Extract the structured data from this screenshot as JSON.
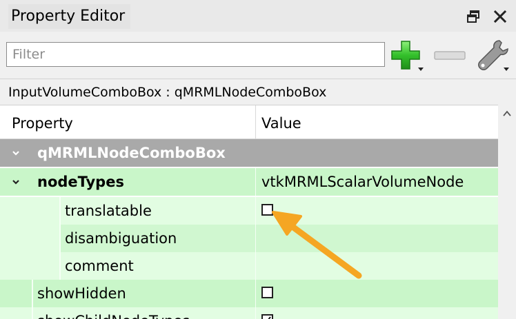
{
  "window": {
    "title": "Property Editor"
  },
  "toolbar": {
    "filter_placeholder": "Filter",
    "filter_value": ""
  },
  "object": {
    "class_line": "InputVolumeComboBox : qMRMLNodeComboBox"
  },
  "tree": {
    "headers": {
      "property": "Property",
      "value": "Value"
    },
    "group": {
      "name": "qMRMLNodeComboBox"
    },
    "rows": [
      {
        "name": "nodeTypes",
        "value": "vtkMRMLScalarVolumeNode"
      },
      {
        "name": "translatable",
        "checked": false
      },
      {
        "name": "disambiguation",
        "value": ""
      },
      {
        "name": "comment",
        "value": ""
      },
      {
        "name": "showHidden",
        "checked": false
      },
      {
        "name": "showChildNodeTypes",
        "checked": true
      }
    ]
  },
  "colors": {
    "group_header": "#a9a9a9",
    "property_row": "#c9f6c9",
    "sub_property_row": "#e2fde2",
    "add_icon": "#2fbf2f",
    "annotation_arrow": "#f5a623"
  },
  "icons": {
    "float": "float-window-icon",
    "close": "close-icon",
    "add": "add-plus-icon",
    "remove": "remove-minus-icon",
    "configure": "wrench-icon"
  }
}
